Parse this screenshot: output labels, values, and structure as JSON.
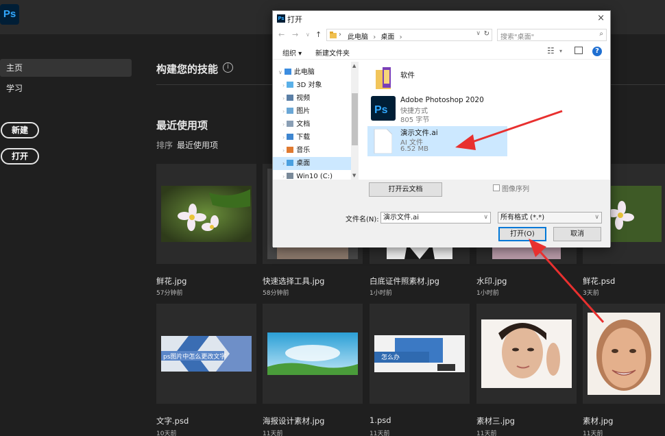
{
  "app": {
    "logo": "Ps"
  },
  "sidebar": {
    "items": [
      {
        "label": "主页"
      },
      {
        "label": "学习"
      }
    ],
    "new_label": "新建",
    "open_label": "打开"
  },
  "main": {
    "skills_title": "构建您的技能",
    "recent_title": "最近使用项",
    "sort_label": "排序",
    "sort_value": "最近使用项"
  },
  "recent": [
    {
      "name": "鲜花.jpg",
      "time": "57分钟前"
    },
    {
      "name": "快速选择工具.jpg",
      "time": "58分钟前"
    },
    {
      "name": "白底证件照素材.jpg",
      "time": "1小时前"
    },
    {
      "name": "水印.jpg",
      "time": "1小时前"
    },
    {
      "name": "鲜花.psd",
      "time": "3天前"
    },
    {
      "name": "文字.psd",
      "time": "10天前"
    },
    {
      "name": "海报设计素材.jpg",
      "time": "11天前"
    },
    {
      "name": "1.psd",
      "time": "11天前"
    },
    {
      "name": "素材三.jpg",
      "time": "11天前"
    },
    {
      "name": "素材.jpg",
      "time": "11天前"
    }
  ],
  "thumb_texts": {
    "text_psd": "ps图片中怎么更改文字",
    "one_psd": "怎么办"
  },
  "dialog": {
    "title": "打开",
    "ps_icon": "Ps",
    "close": "×",
    "path": [
      "此电脑",
      "桌面"
    ],
    "search_placeholder": "搜索\"桌面\"",
    "organize": "组织 ▾",
    "new_folder": "新建文件夹",
    "tree": [
      "此电脑",
      "3D 对象",
      "视频",
      "图片",
      "文档",
      "下载",
      "音乐",
      "桌面",
      "Win10 (C:)"
    ],
    "files": [
      {
        "name": "软件",
        "type": "",
        "size": ""
      },
      {
        "name": "Adobe Photoshop 2020",
        "type": "快捷方式",
        "size": "805 字节"
      },
      {
        "name": "演示文件.ai",
        "type": "AI 文件",
        "size": "6.52 MB"
      }
    ],
    "cloud_button": "打开云文档",
    "image_sequence": "图像序列",
    "filename_label": "文件名(N):",
    "filename_value": "演示文件.ai",
    "filter_value": "所有格式 (*.*)",
    "open_button": "打开(O)",
    "cancel_button": "取消"
  },
  "colors": {
    "arrow": "#e8302f",
    "selection": "#cce8ff",
    "ps_blue": "#31a8ff"
  }
}
